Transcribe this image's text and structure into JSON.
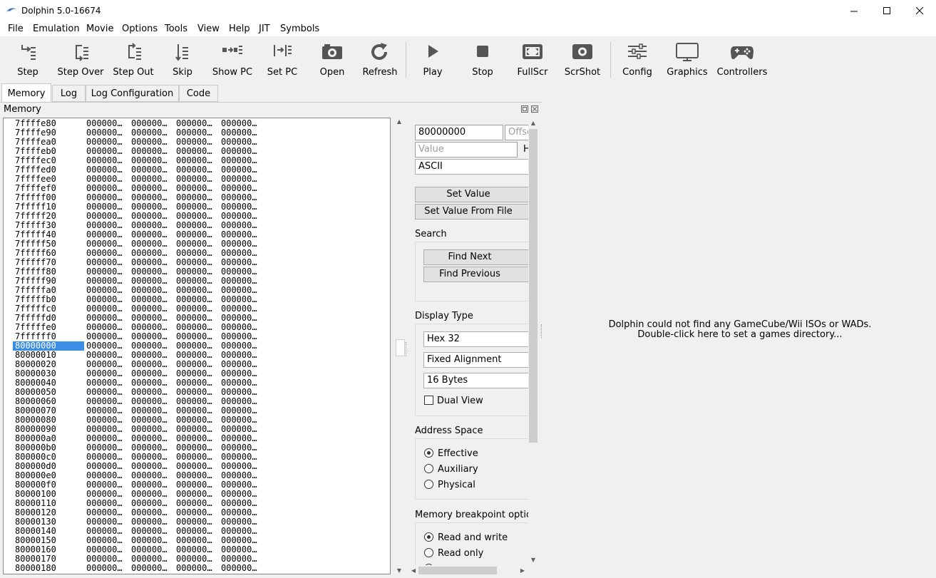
{
  "window": {
    "title": "Dolphin 5.0-16674",
    "controls": {
      "minimize": "minimize",
      "maximize": "maximize",
      "close": "close"
    }
  },
  "menu": [
    "File",
    "Emulation",
    "Movie",
    "Options",
    "Tools",
    "View",
    "Help",
    "JIT",
    "Symbols"
  ],
  "toolbar": [
    {
      "label": "Step",
      "icon": "step-icon"
    },
    {
      "label": "Step Over",
      "icon": "step-over-icon"
    },
    {
      "label": "Step Out",
      "icon": "step-out-icon"
    },
    {
      "label": "Skip",
      "icon": "skip-icon"
    },
    {
      "label": "Show PC",
      "icon": "show-pc-icon"
    },
    {
      "label": "Set PC",
      "icon": "set-pc-icon"
    },
    {
      "label": "Open",
      "icon": "open-icon"
    },
    {
      "label": "Refresh",
      "icon": "refresh-icon"
    },
    {
      "label": "Play",
      "icon": "play-icon"
    },
    {
      "label": "Stop",
      "icon": "stop-icon"
    },
    {
      "label": "FullScr",
      "icon": "fullscreen-icon"
    },
    {
      "label": "ScrShot",
      "icon": "screenshot-icon"
    },
    {
      "label": "Config",
      "icon": "config-icon"
    },
    {
      "label": "Graphics",
      "icon": "graphics-icon"
    },
    {
      "label": "Controllers",
      "icon": "controllers-icon"
    }
  ],
  "tabs": [
    "Memory",
    "Log",
    "Log Configuration",
    "Code"
  ],
  "active_tab": "Memory",
  "panel": {
    "title": "Memory"
  },
  "memory": {
    "addresses": [
      "7ffffe80",
      "7ffffe90",
      "7ffffea0",
      "7ffffeb0",
      "7ffffec0",
      "7ffffed0",
      "7ffffee0",
      "7ffffef0",
      "7fffff00",
      "7fffff10",
      "7fffff20",
      "7fffff30",
      "7fffff40",
      "7fffff50",
      "7fffff60",
      "7fffff70",
      "7fffff80",
      "7fffff90",
      "7fffffa0",
      "7fffffb0",
      "7fffffc0",
      "7fffffd0",
      "7fffffe0",
      "7ffffff0",
      "80000000",
      "80000010",
      "80000020",
      "80000030",
      "80000040",
      "80000050",
      "80000060",
      "80000070",
      "80000080",
      "80000090",
      "800000a0",
      "800000b0",
      "800000c0",
      "800000d0",
      "800000e0",
      "800000f0",
      "80000100",
      "80000110",
      "80000120",
      "80000130",
      "80000140",
      "80000150",
      "80000160",
      "80000170",
      "80000180"
    ],
    "selected_address": "80000000",
    "cell_value": "000000…",
    "columns": 4
  },
  "controls": {
    "address_value": "80000000",
    "offset_placeholder": "Offset",
    "value_placeholder": "Value",
    "hex_label": "H",
    "input_type": "ASCII",
    "set_value": "Set Value",
    "set_value_from_file": "Set Value From File",
    "search_label": "Search",
    "find_next": "Find Next",
    "find_previous": "Find Previous",
    "display_type_label": "Display Type",
    "display_type": "Hex 32",
    "alignment": "Fixed Alignment",
    "row_bytes": "16 Bytes",
    "dual_view": "Dual View",
    "dual_view_checked": false,
    "address_space_label": "Address Space",
    "address_space_options": [
      "Effective",
      "Auxiliary",
      "Physical"
    ],
    "address_space_selected": "Effective",
    "breakpoint_label": "Memory breakpoint option",
    "breakpoint_options": [
      "Read and write",
      "Read only"
    ],
    "breakpoint_selected": "Read and write"
  },
  "game_list": {
    "message_line1": "Dolphin could not find any GameCube/Wii ISOs or WADs.",
    "message_line2": "Double-click here to set a games directory..."
  }
}
